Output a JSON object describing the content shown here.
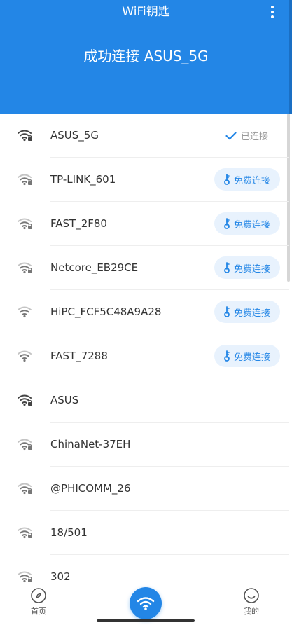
{
  "header": {
    "app_title": "WiFi钥匙",
    "status_title": "成功连接 ASUS_5G",
    "more_icon": "more-vertical-icon",
    "color": "#2386e6"
  },
  "networks": [
    {
      "ssid": "ASUS_5G",
      "status": "已连接",
      "type": "connected",
      "signal_icon": "wifi-lock-icon"
    },
    {
      "ssid": "TP-LINK_601",
      "action": "免费连接",
      "type": "free",
      "signal_icon": "wifi-lock-icon"
    },
    {
      "ssid": "FAST_2F80",
      "action": "免费连接",
      "type": "free",
      "signal_icon": "wifi-lock-icon"
    },
    {
      "ssid": "Netcore_EB29CE",
      "action": "免费连接",
      "type": "free",
      "signal_icon": "wifi-lock-icon"
    },
    {
      "ssid": "HiPC_FCF5C48A9A28",
      "action": "免费连接",
      "type": "free",
      "signal_icon": "wifi-icon"
    },
    {
      "ssid": "FAST_7288",
      "action": "免费连接",
      "type": "free",
      "signal_icon": "wifi-icon"
    },
    {
      "ssid": "ASUS",
      "type": "locked",
      "signal_icon": "wifi-lock-icon"
    },
    {
      "ssid": "ChinaNet-37EH",
      "type": "locked",
      "signal_icon": "wifi-lock-icon"
    },
    {
      "ssid": "@PHICOMM_26",
      "type": "locked",
      "signal_icon": "wifi-lock-icon"
    },
    {
      "ssid": "18/501",
      "type": "locked",
      "signal_icon": "wifi-lock-icon"
    },
    {
      "ssid": "302",
      "type": "locked",
      "signal_icon": "wifi-lock-icon"
    }
  ],
  "bottom_nav": {
    "home_label": "首页",
    "me_label": "我的",
    "home_icon": "compass-icon",
    "center_icon": "wifi-icon",
    "me_icon": "smiley-icon"
  },
  "colors": {
    "accent": "#2386e6",
    "button_bg": "#e8f2fd",
    "connected_text": "#9a9a9a"
  }
}
